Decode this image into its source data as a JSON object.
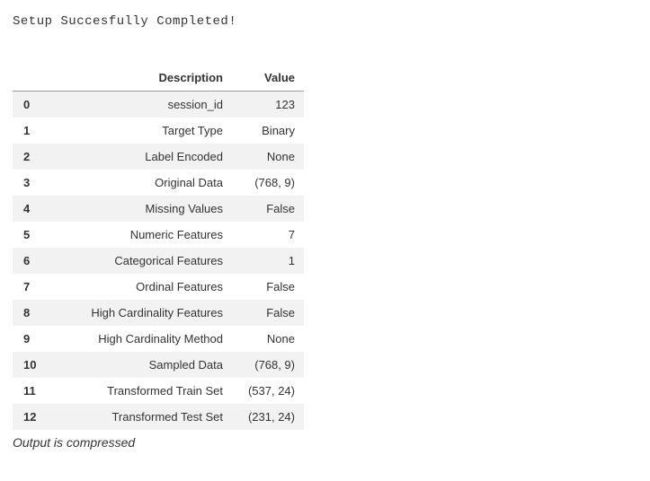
{
  "heading": "Setup Succesfully Completed!",
  "table": {
    "columns": {
      "index": "",
      "description": "Description",
      "value": "Value"
    },
    "rows": [
      {
        "index": "0",
        "description": "session_id",
        "value": "123"
      },
      {
        "index": "1",
        "description": "Target Type",
        "value": "Binary"
      },
      {
        "index": "2",
        "description": "Label Encoded",
        "value": "None"
      },
      {
        "index": "3",
        "description": "Original Data",
        "value": "(768, 9)"
      },
      {
        "index": "4",
        "description": "Missing Values",
        "value": "False"
      },
      {
        "index": "5",
        "description": "Numeric Features",
        "value": "7"
      },
      {
        "index": "6",
        "description": "Categorical Features",
        "value": "1"
      },
      {
        "index": "7",
        "description": "Ordinal Features",
        "value": "False"
      },
      {
        "index": "8",
        "description": "High Cardinality Features",
        "value": "False"
      },
      {
        "index": "9",
        "description": "High Cardinality Method",
        "value": "None"
      },
      {
        "index": "10",
        "description": "Sampled Data",
        "value": "(768, 9)"
      },
      {
        "index": "11",
        "description": "Transformed Train Set",
        "value": "(537, 24)"
      },
      {
        "index": "12",
        "description": "Transformed Test Set",
        "value": "(231, 24)"
      }
    ]
  },
  "footer_note": "Output is compressed"
}
